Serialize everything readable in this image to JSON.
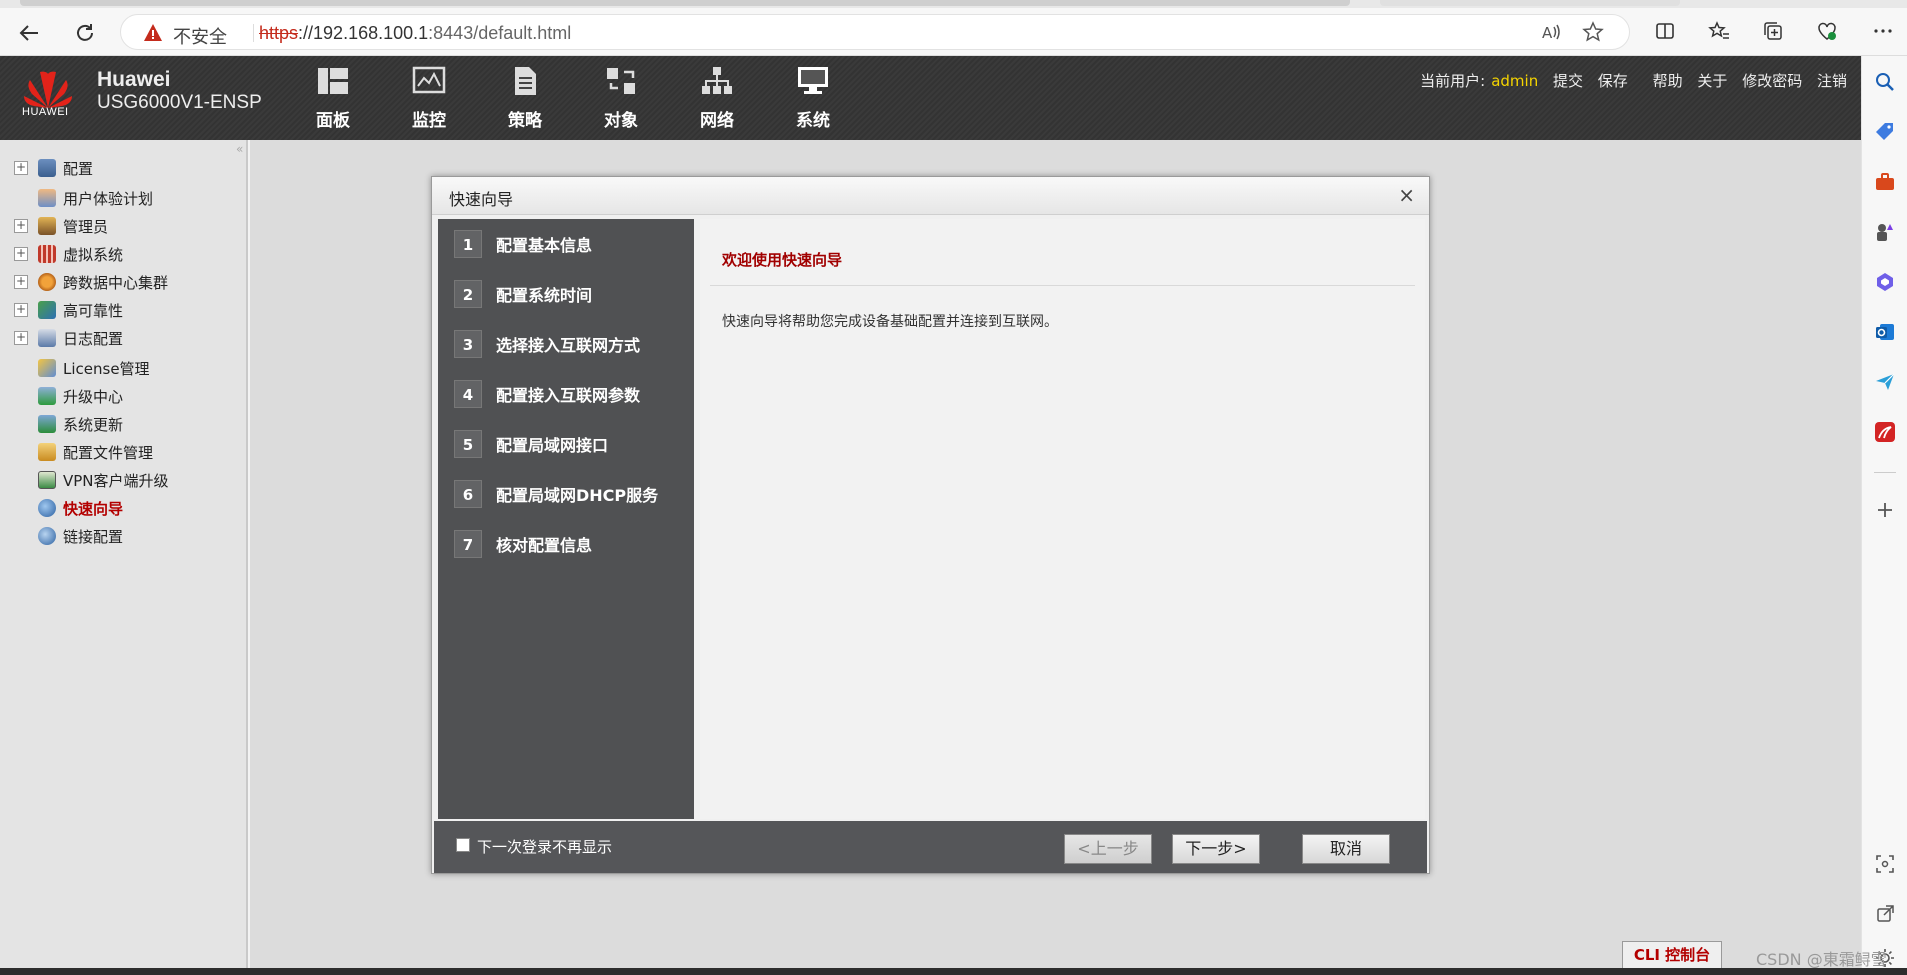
{
  "browser": {
    "security_label": "不安全",
    "url_protocol": "https",
    "url_host": "://192.168.100.1",
    "url_rest": ":8443/default.html"
  },
  "header": {
    "brand_name": "Huawei",
    "device_model": "USG6000V1-ENSP",
    "logo_text": "HUAWEI",
    "nav": [
      {
        "label": "面板"
      },
      {
        "label": "监控"
      },
      {
        "label": "策略"
      },
      {
        "label": "对象"
      },
      {
        "label": "网络"
      },
      {
        "label": "系统"
      }
    ],
    "current_user_label": "当前用户:",
    "current_user": "admin",
    "links": [
      "提交",
      "保存",
      "帮助",
      "关于",
      "修改密码",
      "注销"
    ]
  },
  "sidebar": {
    "items": [
      {
        "label": "配置",
        "expandable": true
      },
      {
        "label": "用户体验计划",
        "expandable": false
      },
      {
        "label": "管理员",
        "expandable": true
      },
      {
        "label": "虚拟系统",
        "expandable": true
      },
      {
        "label": "跨数据中心集群",
        "expandable": true
      },
      {
        "label": "高可靠性",
        "expandable": true
      },
      {
        "label": "日志配置",
        "expandable": true
      },
      {
        "label": "License管理",
        "expandable": false
      },
      {
        "label": "升级中心",
        "expandable": false
      },
      {
        "label": "系统更新",
        "expandable": false
      },
      {
        "label": "配置文件管理",
        "expandable": false
      },
      {
        "label": "VPN客户端升级",
        "expandable": false
      },
      {
        "label": "快速向导",
        "expandable": false,
        "active": true
      },
      {
        "label": "链接配置",
        "expandable": false
      }
    ]
  },
  "wizard": {
    "title": "快速向导",
    "steps": [
      {
        "num": "1",
        "label": "配置基本信息"
      },
      {
        "num": "2",
        "label": "配置系统时间"
      },
      {
        "num": "3",
        "label": "选择接入互联网方式"
      },
      {
        "num": "4",
        "label": "配置接入互联网参数"
      },
      {
        "num": "5",
        "label": "配置局域网接口"
      },
      {
        "num": "6",
        "label": "配置局域网DHCP服务"
      },
      {
        "num": "7",
        "label": "核对配置信息"
      }
    ],
    "welcome": "欢迎使用快速向导",
    "description": "快速向导将帮助您完成设备基础配置并连接到互联网。",
    "dont_show_label": "下一次登录不再显示",
    "dont_show_checked": false,
    "prev_label": "<上一步",
    "next_label": "下一步>",
    "cancel_label": "取消"
  },
  "footer": {
    "cli_label": "CLI 控制台",
    "watermark": "CSDN @東霜鲟雪"
  },
  "colors": {
    "accent_red": "#b30000",
    "admin_yellow": "#f5d400",
    "header_dark": "#353535",
    "wizard_step_bg": "#505153"
  }
}
